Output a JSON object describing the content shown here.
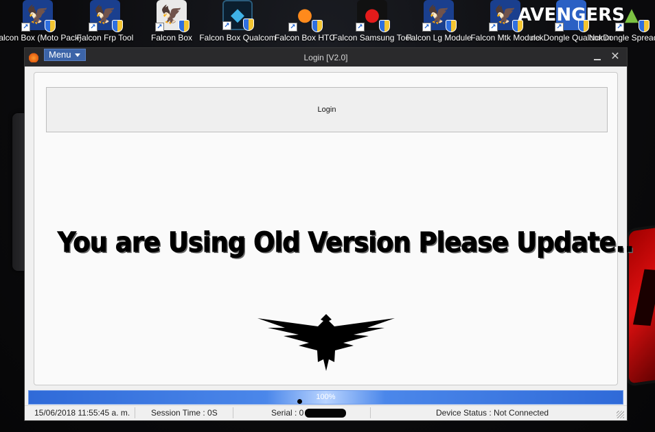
{
  "desktop": {
    "icons": [
      {
        "label": "Falcon Box (Moto Pack)",
        "icon": "falcon-box-icon"
      },
      {
        "label": "Falcon Frp Tool",
        "icon": "falcon-box-icon"
      },
      {
        "label": "Falcon Box",
        "icon": "falcon-atlanta-icon"
      },
      {
        "label": "Falcon Box Qualcom",
        "icon": "qualcomm-icon"
      },
      {
        "label": "Falcon Box HTC",
        "icon": "htc-bird-icon"
      },
      {
        "label": "Falcon Samsung Tool",
        "icon": "angry-bird-icon"
      },
      {
        "label": "Falcon Lg Module",
        "icon": "falcon-box-icon"
      },
      {
        "label": "Falcon Mtk Module",
        "icon": "falcon-box-icon"
      },
      {
        "label": "nckDongle Qualcomm",
        "icon": "avengers-icon",
        "icon_text": "AVENGERS"
      },
      {
        "label": "NckDongle Spreadtrum",
        "icon": "android-icon"
      }
    ]
  },
  "window": {
    "menu_label": "Menu",
    "title": "Login [V2.0]"
  },
  "main": {
    "login_button": "Login",
    "update_message": "You are Using Old Version Please Update.."
  },
  "progress": {
    "value": 100,
    "label": "100%"
  },
  "status_bar": {
    "datetime": "15/06/2018 11:55:45 a. m.",
    "session_time": "Session Time : 0S",
    "serial_label": "Serial : 0",
    "device_status": "Device Status : Not Connected"
  },
  "colors": {
    "title_bar": "#2a2a2c",
    "menu_button": "#3c64a8",
    "progress": "#3f7ae0"
  }
}
